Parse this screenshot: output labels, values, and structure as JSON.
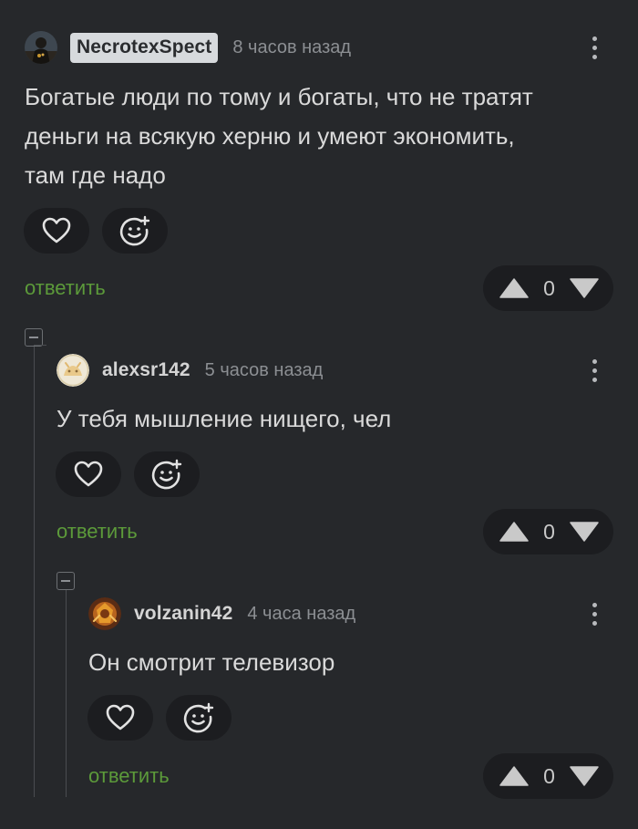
{
  "comments": [
    {
      "username": "NecrotexSpect",
      "time": "8 часов назад",
      "text": "Богатые люди по тому и богаты, что не тратят\nденьги на всякую херню и умеют экономить,\nтам где надо",
      "reply_label": "ответить",
      "votes": "0"
    },
    {
      "username": "alexsr142",
      "time": "5 часов назад",
      "text": "У тебя мышление нищего, чел",
      "reply_label": "ответить",
      "votes": "0"
    },
    {
      "username": "volzanin42",
      "time": "4 часа назад",
      "text": "Он смотрит телевизор",
      "reply_label": "ответить",
      "votes": "0"
    }
  ],
  "colors": {
    "background": "#26282b",
    "reply_link": "#5c9a3a",
    "button_bg": "#1c1d20"
  },
  "icons": [
    "heart-icon",
    "emoji-add-icon",
    "upvote-icon",
    "downvote-icon",
    "more-vertical-icon",
    "collapse-icon"
  ]
}
